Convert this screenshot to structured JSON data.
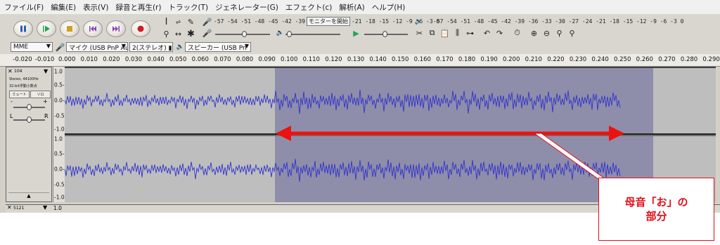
{
  "menu": [
    "ファイル(F)",
    "編集(E)",
    "表示(V)",
    "録音と再生(r)",
    "トラック(T)",
    "ジェネレーター(G)",
    "エフェクト(c)",
    "解析(A)",
    "ヘルプ(H)"
  ],
  "toolbar": {
    "transport": [
      "pause-icon",
      "play-icon",
      "stop-icon",
      "skip-start-icon",
      "skip-end-icon",
      "record-icon"
    ],
    "rec_meter_scale": "-57 -54 -51 -48 -45 -42 -39",
    "monitor_label": "モニターを開始",
    "rec_meter_scale_tail": "-21 -18 -15 -12  -9  -6  -3  0",
    "play_meter_scale": "-57 -54 -51 -48 -45 -42 -39 -36 -33 -30 -27 -24 -21 -18 -15 -12  -9  -6  -3  0"
  },
  "devices": {
    "host": "MME",
    "mic": "マイク (USB PnP Au",
    "channels": "2(ステレオ) ▮",
    "speaker": "スピーカー (USB Pn"
  },
  "ruler_ticks": [
    "-0.020",
    "-0.010",
    "0.000",
    "0.010",
    "0.020",
    "0.030",
    "0.040",
    "0.050",
    "0.060",
    "0.070",
    "0.080",
    "0.090",
    "0.100",
    "0.110",
    "0.120",
    "0.130",
    "0.140",
    "0.150",
    "0.160",
    "0.170",
    "0.180",
    "0.190",
    "0.200",
    "0.210",
    "0.220",
    "0.230",
    "0.240",
    "0.250",
    "0.260",
    "0.270",
    "0.280",
    "0.290"
  ],
  "track": {
    "name": "104",
    "info_line1": "Stereo, 44100Hz",
    "info_line2": "32-bit浮動小数点",
    "mute": "ミュート",
    "solo": "ソロ",
    "gain_minus": "-",
    "gain_plus": "+",
    "pan_left": "L",
    "pan_right": "R",
    "scale_labels": [
      "1.0",
      "0.5-",
      "0.0-",
      "-0.5-",
      "-1.0",
      "1.0",
      "0.5-",
      "0.0-",
      "-0.5-",
      "-1.0"
    ]
  },
  "next_track": {
    "name": "5121",
    "scale_top": "1.0"
  },
  "callout": {
    "line1": "母音「お」の",
    "line2": "部分"
  },
  "colors": {
    "waveform": "#3333cc",
    "selection": "#8e8eaa",
    "arrow": "#ee1111",
    "callout_border": "#e0101a"
  }
}
